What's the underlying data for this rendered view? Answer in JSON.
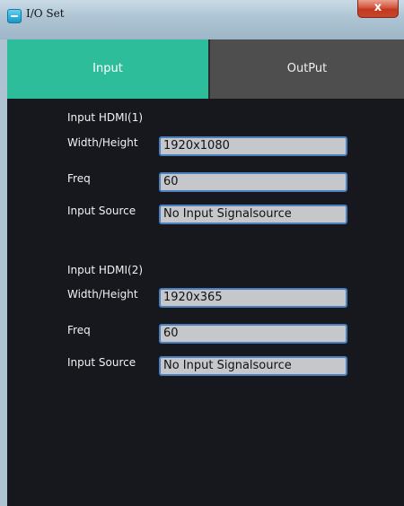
{
  "window": {
    "title": "I/O Set",
    "close_label": "x"
  },
  "tabs": [
    {
      "label": "Input",
      "active": true
    },
    {
      "label": "OutPut",
      "active": false
    }
  ],
  "sections": [
    {
      "header": "Input HDMI(1)",
      "rows": [
        {
          "label": "Width/Height",
          "value": "1920x1080"
        },
        {
          "label": "Freq",
          "value": "60"
        },
        {
          "label": "Input Source",
          "value": "No Input Signalsource"
        }
      ]
    },
    {
      "header": "Input HDMI(2)",
      "rows": [
        {
          "label": "Width/Height",
          "value": "1920x365"
        },
        {
          "label": "Freq",
          "value": "60"
        },
        {
          "label": "Input Source",
          "value": "No Input Signalsource"
        }
      ]
    }
  ],
  "colors": {
    "active_tab": "#2ebd9b",
    "inactive_tab": "#4e4e4e",
    "panel_background": "#16181e",
    "field_border": "#4a7fc0"
  }
}
